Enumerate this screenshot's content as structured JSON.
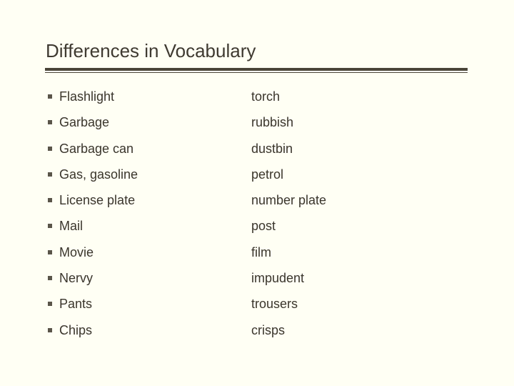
{
  "slide": {
    "title": "Differences in Vocabulary",
    "rows": [
      {
        "us": "Flashlight",
        "uk": "torch"
      },
      {
        "us": "Garbage",
        "uk": "rubbish"
      },
      {
        "us": "Garbage can",
        "uk": "dustbin"
      },
      {
        "us": "Gas, gasoline",
        "uk": "petrol"
      },
      {
        "us": "License plate",
        "uk": "number plate"
      },
      {
        "us": "Mail",
        "uk": "post"
      },
      {
        "us": "Movie",
        "uk": "film"
      },
      {
        "us": "Nervy",
        "uk": "impudent"
      },
      {
        "us": "Pants",
        "uk": "trousers"
      },
      {
        "us": "Chips",
        "uk": "crisps"
      }
    ]
  }
}
